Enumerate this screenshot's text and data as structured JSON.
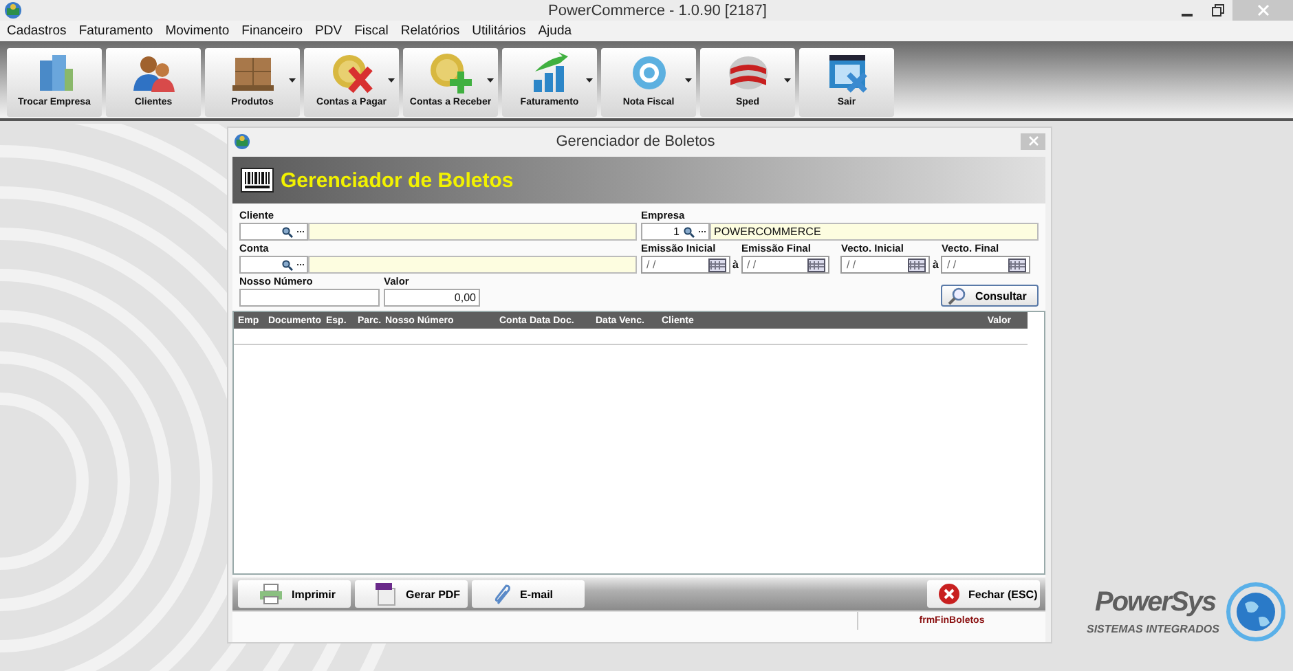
{
  "app_title": "PowerCommerce - 1.0.90 [2187]",
  "menu": [
    "Cadastros",
    "Faturamento",
    "Movimento",
    "Financeiro",
    "PDV",
    "Fiscal",
    "Relatórios",
    "Utilitários",
    "Ajuda"
  ],
  "toolbar": [
    {
      "label": "Trocar Empresa",
      "has_menu": false
    },
    {
      "label": "Clientes",
      "has_menu": false
    },
    {
      "label": "Produtos",
      "has_menu": true
    },
    {
      "label": "Contas a Pagar",
      "has_menu": true
    },
    {
      "label": "Contas a Receber",
      "has_menu": true
    },
    {
      "label": "Faturamento",
      "has_menu": true
    },
    {
      "label": "Nota Fiscal",
      "has_menu": true
    },
    {
      "label": "Sped",
      "has_menu": true
    },
    {
      "label": "Sair",
      "has_menu": false
    }
  ],
  "dialog": {
    "title": "Gerenciador de Boletos",
    "header": "Gerenciador de Boletos",
    "cliente": {
      "label": "Cliente"
    },
    "empresa": {
      "label": "Empresa",
      "code": "1",
      "name": "POWERCOMMERCE"
    },
    "conta": {
      "label": "Conta"
    },
    "dates": [
      {
        "label": "Emissão Inicial",
        "value": "/ /"
      },
      {
        "label": "Emissão Final",
        "value": "/ /"
      },
      {
        "label": "Vecto. Inicial",
        "value": "/ /"
      },
      {
        "label": "Vecto. Final",
        "value": "/ /"
      }
    ],
    "date_separators": [
      "à",
      "à"
    ],
    "nosso_numero": {
      "label": "Nosso Número"
    },
    "valor": {
      "label": "Valor",
      "value": "0,00"
    },
    "search_button": "Consultar",
    "columns": [
      "Emp",
      "Documento",
      "Esp.",
      "Parc.",
      "Nosso Número",
      "Conta",
      "Data Doc.",
      "Data Venc.",
      "Cliente",
      "Valor"
    ],
    "actions": [
      "Imprimir",
      "Gerar PDF",
      "E-mail"
    ],
    "close_button": "Fechar (ESC)",
    "status_bar": {
      "form_name": "frmFinBoletos"
    }
  },
  "brand": {
    "name": "PowerSys",
    "tagline": "SISTEMAS INTEGRADOS"
  }
}
